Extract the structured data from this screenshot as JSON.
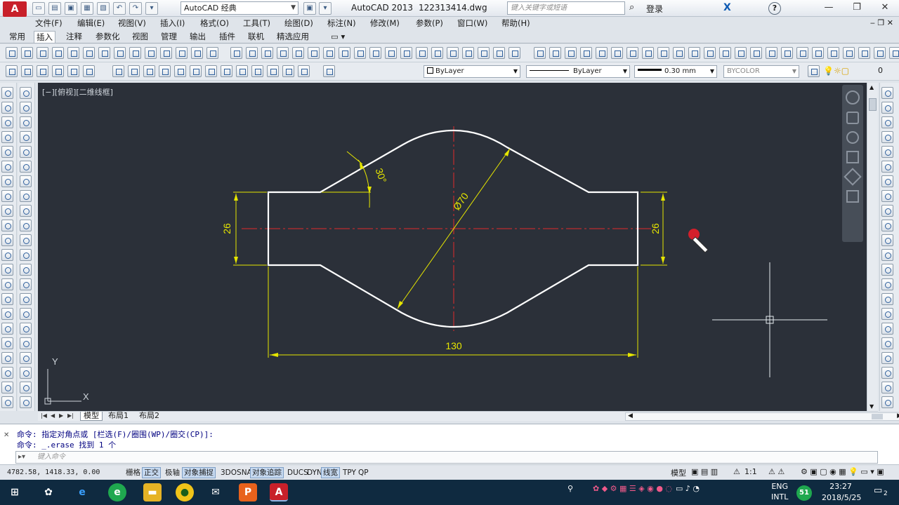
{
  "titlebar": {
    "logo": "A",
    "workspace": "AutoCAD 经典",
    "app_title": "AutoCAD 2013",
    "file_name": "122313414.dwg",
    "search_placeholder": "键入关键字或短语",
    "login": "登录",
    "help": "?",
    "exchange": "X",
    "buttons": [
      "—",
      "❐",
      "✕"
    ]
  },
  "menubar": {
    "items": [
      "文件(F)",
      "编辑(E)",
      "视图(V)",
      "插入(I)",
      "格式(O)",
      "工具(T)",
      "绘图(D)",
      "标注(N)",
      "修改(M)",
      "参数(P)",
      "窗口(W)",
      "帮助(H)"
    ]
  },
  "ribbon": {
    "tabs": [
      "常用",
      "插入",
      "注释",
      "参数化",
      "视图",
      "管理",
      "输出",
      "插件",
      "联机",
      "精选应用"
    ],
    "active_tab": "插入"
  },
  "properties": {
    "layer_color": "ByLayer",
    "linetype": "ByLayer",
    "lineweight": "0.30 mm",
    "plotstyle": "BYCOLOR",
    "layer_count": "0"
  },
  "canvas": {
    "view_label": "[−][俯视][二维线框]",
    "background": "#2b3039",
    "dims": {
      "angle": "30°",
      "diameter": "Ø70",
      "left_height": "26",
      "right_height": "26",
      "width": "130"
    },
    "ucs": {
      "x": "X",
      "y": "Y"
    },
    "colors": {
      "outline": "#ffffff",
      "dimension": "#e6e600",
      "centerline": "#e02a2a"
    }
  },
  "layout_tabs": {
    "tabs": [
      "模型",
      "布局1",
      "布局2"
    ],
    "active": "模型"
  },
  "command": {
    "lines": [
      "命令: 指定对角点或 [栏选(F)/圈围(WP)/圈交(CP)]:",
      "命令: _.erase 找到 1 个"
    ],
    "placeholder": "键入命令"
  },
  "statusbar": {
    "coords": "4782.58, 1418.33, 0.00",
    "toggles": [
      {
        "label": "栅格",
        "on": false
      },
      {
        "label": "正交",
        "on": true
      },
      {
        "label": "极轴",
        "on": false
      },
      {
        "label": "对象捕捉",
        "on": true
      },
      {
        "label": "3DOSNAP",
        "on": false
      },
      {
        "label": "对象追踪",
        "on": true
      },
      {
        "label": "DUCS",
        "on": false
      },
      {
        "label": "DYN",
        "on": false
      },
      {
        "label": "线宽",
        "on": true
      },
      {
        "label": "TPY",
        "on": false
      },
      {
        "label": "QP",
        "on": false
      }
    ],
    "model": "模型",
    "scale": "1:1"
  },
  "taskbar": {
    "lang_top": "ENG",
    "lang_bottom": "INTL",
    "badge": "51",
    "time": "23:27",
    "date": "2018/5/25",
    "notifications": "2"
  }
}
